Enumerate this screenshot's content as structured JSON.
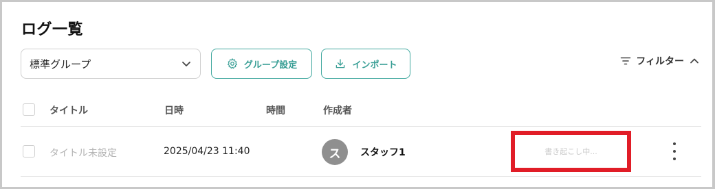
{
  "page": {
    "title": "ログ一覧"
  },
  "toolbar": {
    "group_select_value": "標準グループ",
    "group_settings_label": "グループ設定",
    "import_label": "インポート",
    "filter_label": "フィルター"
  },
  "table": {
    "headers": {
      "title": "タイトル",
      "datetime": "日時",
      "duration": "時間",
      "author": "作成者"
    },
    "rows": [
      {
        "title": "タイトル未設定",
        "datetime": "2025/04/23 11:40",
        "duration": "",
        "author_initial": "ス",
        "author_name": "スタッフ1",
        "status": "書き起こし中..."
      }
    ]
  },
  "colors": {
    "accent": "#3fa79e",
    "highlight_box": "#e11d27",
    "avatar_bg": "#8f8f8f"
  },
  "icons": {
    "group_settings": "gear-icon",
    "import": "download-icon",
    "filter": "filter-icon",
    "filter_toggle": "chevron-up-icon",
    "select": "chevron-down-icon",
    "row_menu": "kebab-menu-icon"
  }
}
